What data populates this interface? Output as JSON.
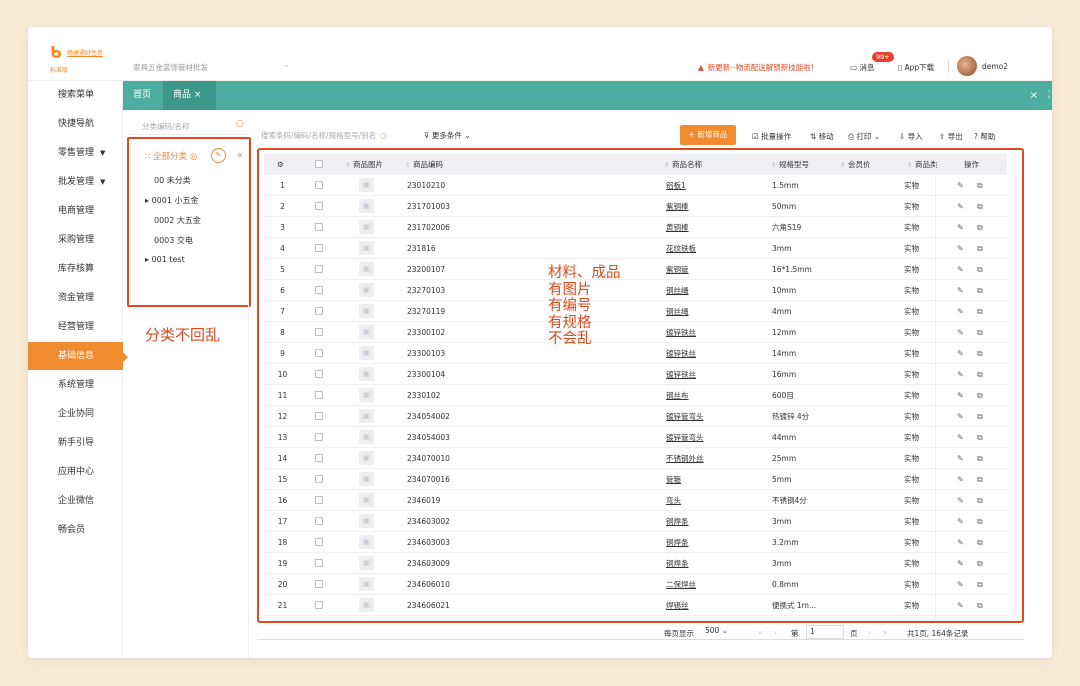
{
  "header": {
    "logo_name": "畅捷通好生意",
    "edition": "标准版",
    "store_select": "家具五金装饰管材批发",
    "notice": "新更新--物流配送解锁新技能啦!",
    "messages_label": "消息",
    "messages_badge": "99+",
    "app_download": "App下载",
    "username": "demo2"
  },
  "nav": {
    "items": [
      {
        "label": "搜索菜单",
        "caret": ""
      },
      {
        "label": "快捷导航",
        "caret": ""
      },
      {
        "label": "零售管理",
        "caret": "▼"
      },
      {
        "label": "批发管理",
        "caret": "▼"
      },
      {
        "label": "电商管理",
        "caret": ""
      },
      {
        "label": "采购管理",
        "caret": ""
      },
      {
        "label": "库存核算",
        "caret": ""
      },
      {
        "label": "资金管理",
        "caret": ""
      },
      {
        "label": "经营管理",
        "caret": ""
      },
      {
        "label": "基础信息",
        "caret": ""
      },
      {
        "label": "系统管理",
        "caret": ""
      },
      {
        "label": "企业协同",
        "caret": ""
      },
      {
        "label": "新手引导",
        "caret": ""
      },
      {
        "label": "应用中心",
        "caret": ""
      },
      {
        "label": "企业微信",
        "caret": ""
      },
      {
        "label": "畅会员",
        "caret": ""
      }
    ],
    "active_index": 9
  },
  "tabs": {
    "home": "首页",
    "current": "商品",
    "current_close": "×",
    "close_all": "×",
    "fullscreen": "⛶"
  },
  "category": {
    "search_placeholder": "分类编码/名称",
    "root": "全部分类",
    "items": [
      {
        "label": "00 未分类",
        "expandable": false
      },
      {
        "label": "0001 小五金",
        "expandable": true
      },
      {
        "label": "0002 大五金",
        "expandable": false
      },
      {
        "label": "0003 交电",
        "expandable": false
      },
      {
        "label": "001 test",
        "expandable": true
      }
    ],
    "collapse_icon": "«"
  },
  "annotations": {
    "category_note": "分类不回乱",
    "table_note": [
      "材料、成品",
      "有图片",
      "有编号",
      "有规格",
      "不会乱"
    ]
  },
  "toolbar": {
    "search_placeholder": "搜索条码/编码/名称/规格型号/别名",
    "more_conditions": "更多条件",
    "add_button": "+ 新增商品",
    "batch": "批量操作",
    "move": "移动",
    "print": "打印",
    "import": "导入",
    "export": "导出",
    "help": "帮助"
  },
  "table": {
    "headers": {
      "image": "商品图片",
      "code": "商品编码",
      "name": "商品名称",
      "spec": "规格型号",
      "member_price": "会员价",
      "type": "商品类",
      "op": "操作"
    },
    "rows": [
      {
        "no": "1",
        "code": "23010210",
        "name": "铝板1",
        "spec": "1.5mm",
        "type": "实物"
      },
      {
        "no": "2",
        "code": "231701003",
        "name": "紫铜棒",
        "spec": "50mm",
        "type": "实物"
      },
      {
        "no": "3",
        "code": "231702006",
        "name": "黄铜棒",
        "spec": "六角S19",
        "type": "实物"
      },
      {
        "no": "4",
        "code": "231816",
        "name": "花纹铁板",
        "spec": "3mm",
        "type": "实物"
      },
      {
        "no": "5",
        "code": "23200107",
        "name": "紫铜管",
        "spec": "16*1.5mm",
        "type": "实物"
      },
      {
        "no": "6",
        "code": "23270103",
        "name": "钢丝绳",
        "spec": "10mm",
        "type": "实物"
      },
      {
        "no": "7",
        "code": "23270119",
        "name": "钢丝绳",
        "spec": "4mm",
        "type": "实物"
      },
      {
        "no": "8",
        "code": "23300102",
        "name": "镀锌铁丝",
        "spec": "12mm",
        "type": "实物"
      },
      {
        "no": "9",
        "code": "23300103",
        "name": "镀锌铁丝",
        "spec": "14mm",
        "type": "实物"
      },
      {
        "no": "10",
        "code": "23300104",
        "name": "镀锌铁丝",
        "spec": "16mm",
        "type": "实物"
      },
      {
        "no": "11",
        "code": "2330102",
        "name": "钢丝布",
        "spec": "600目",
        "type": "实物"
      },
      {
        "no": "12",
        "code": "234054002",
        "name": "镀锌管弯头",
        "spec": "热镀锌 4分",
        "type": "实物"
      },
      {
        "no": "13",
        "code": "234054003",
        "name": "镀锌管弯头",
        "spec": "44mm",
        "type": "实物"
      },
      {
        "no": "14",
        "code": "234070010",
        "name": "不锈钢外丝",
        "spec": "25mm",
        "type": "实物"
      },
      {
        "no": "15",
        "code": "234070016",
        "name": "管箍",
        "spec": "5mm",
        "type": "实物"
      },
      {
        "no": "16",
        "code": "2346019",
        "name": "弯头",
        "spec": "不锈钢4分",
        "type": "实物"
      },
      {
        "no": "17",
        "code": "234603002",
        "name": "铜焊条",
        "spec": "3mm",
        "type": "实物"
      },
      {
        "no": "18",
        "code": "234603003",
        "name": "铜焊条",
        "spec": "3.2mm",
        "type": "实物"
      },
      {
        "no": "19",
        "code": "234603009",
        "name": "铜焊条",
        "spec": "3mm",
        "type": "实物"
      },
      {
        "no": "20",
        "code": "234606010",
        "name": "二保焊丝",
        "spec": "0.8mm",
        "type": "实物"
      },
      {
        "no": "21",
        "code": "234606021",
        "name": "焊锡丝",
        "spec": "便携式 1m...",
        "type": "实物"
      }
    ]
  },
  "pager": {
    "per_page_label": "每页显示",
    "per_page": "500",
    "page_prefix": "第",
    "page": "1",
    "page_suffix": "页",
    "summary": "共1页, 164条记录"
  },
  "colors": {
    "accent": "#f08b2f",
    "teal": "#4dada0",
    "annotation_red": "#e0491e"
  }
}
